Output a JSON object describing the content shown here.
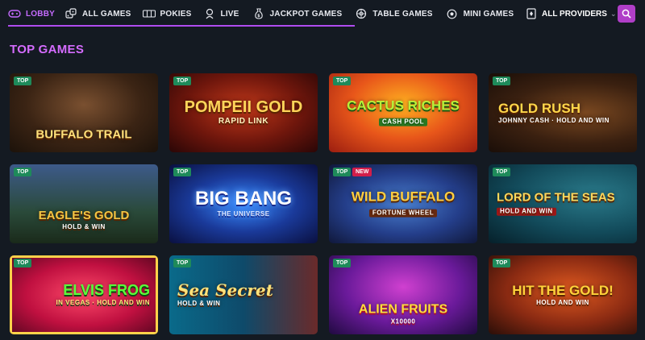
{
  "nav": {
    "items": [
      {
        "label": "LOBBY",
        "icon": "controller-icon"
      },
      {
        "label": "ALL GAMES",
        "icon": "dice-icon"
      },
      {
        "label": "POKIES",
        "icon": "slot-reels-icon"
      },
      {
        "label": "LIVE",
        "icon": "dealer-icon"
      },
      {
        "label": "JACKPOT GAMES",
        "icon": "money-bag-icon"
      },
      {
        "label": "TABLE GAMES",
        "icon": "roulette-icon"
      },
      {
        "label": "MINI GAMES",
        "icon": "ball-icon"
      },
      {
        "label": "",
        "icon": "cards-icon"
      }
    ],
    "providers_label": "ALL PROVIDERS",
    "accent": "#b04cf0"
  },
  "section": {
    "title": "TOP GAMES"
  },
  "games": [
    {
      "title": "BUFFALO TRAIL",
      "subtitle": "",
      "badges": [
        "TOP"
      ]
    },
    {
      "title": "POMPEII GOLD",
      "subtitle": "RAPID LINK",
      "badges": [
        "TOP"
      ]
    },
    {
      "title": "CACTUS RICHES",
      "subtitle": "CASH POOL",
      "badges": [
        "TOP"
      ]
    },
    {
      "title": "GOLD RUSH",
      "subtitle": "JOHNNY CASH · HOLD AND WIN",
      "badges": [
        "TOP"
      ]
    },
    {
      "title": "EAGLE'S GOLD",
      "subtitle": "HOLD & WIN",
      "badges": [
        "TOP"
      ]
    },
    {
      "title": "BIG BANG",
      "subtitle": "THE UNIVERSE",
      "badges": [
        "TOP"
      ]
    },
    {
      "title": "WILD BUFFALO",
      "subtitle": "FORTUNE WHEEL",
      "badges": [
        "TOP",
        "NEW"
      ]
    },
    {
      "title": "LORD OF THE SEAS",
      "subtitle": "HOLD AND WIN",
      "badges": [
        "TOP"
      ]
    },
    {
      "title": "ELVIS FROG",
      "subtitle": "IN VEGAS · HOLD AND WIN",
      "badges": [
        "TOP"
      ]
    },
    {
      "title": "Sea Secret",
      "subtitle": "HOLD & WIN",
      "badges": [
        "TOP"
      ]
    },
    {
      "title": "ALIEN FRUITS",
      "subtitle": "X10000",
      "badges": [
        "TOP"
      ]
    },
    {
      "title": "HIT THE GOLD!",
      "subtitle": "HOLD AND WIN",
      "badges": [
        "TOP"
      ]
    }
  ]
}
